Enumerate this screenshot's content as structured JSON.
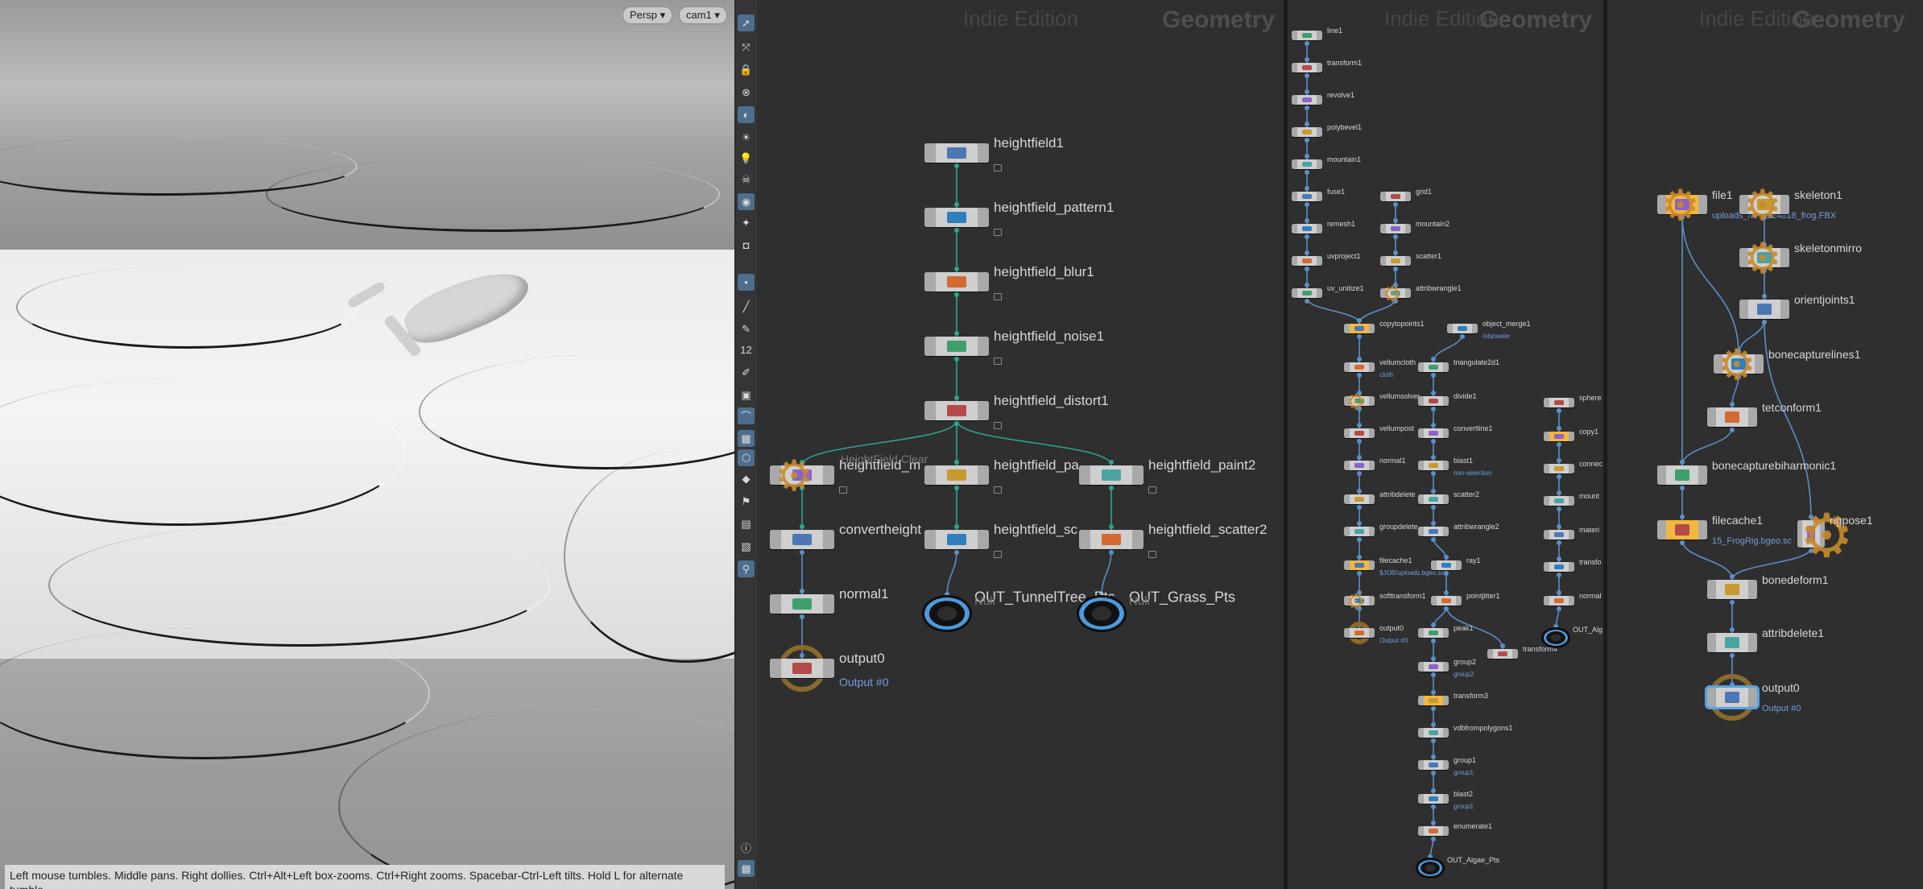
{
  "viewport": {
    "persp_label": "Persp ▾",
    "cam_label": "cam1 ▾",
    "hint_text": "Left mouse tumbles. Middle pans. Right dollies. Ctrl+Alt+Left box-zooms. Ctrl+Right zooms. Spacebar-Ctrl-Left tilts. Hold L for alternate tumble,"
  },
  "toolbar": {
    "icons": [
      "select-icon",
      "transform-icon",
      "lock-icon",
      "hide-icon",
      "shading-icon",
      "light-icon",
      "bulb-icon",
      "skull-icon",
      "camera-icon",
      "pose-icon",
      "snapshot-icon",
      "point-icon",
      "measure-icon",
      "pen-icon",
      "number-icon",
      "paint-icon",
      "stamp-icon",
      "curve-icon",
      "grid-icon",
      "wire-icon",
      "display-icon",
      "flag-icon",
      "image-icon",
      "background-icon",
      "pin-icon",
      "info-icon",
      "layout-icon"
    ],
    "twelve": "12"
  },
  "panes": {
    "pane1": {
      "edition": "Indie Edition",
      "context": "Geometry"
    },
    "pane2": {
      "edition": "Indie Edition",
      "context": "Geometry"
    },
    "pane3": {
      "edition": "Indie Edition",
      "context": "Geometry"
    }
  },
  "net1": {
    "nodes": [
      {
        "name": "heightfield1",
        "sub": ""
      },
      {
        "name": "heightfield_pattern1",
        "sub": ""
      },
      {
        "name": "heightfield_blur1",
        "sub": ""
      },
      {
        "name": "heightfield_noise1",
        "sub": ""
      },
      {
        "name": "heightfield_distort1",
        "sub": ""
      },
      {
        "name": "heightfield_m",
        "sub": ""
      },
      {
        "name": "heightfield_pa",
        "sub": ""
      },
      {
        "name": "heightfield_paint2",
        "sub": ""
      },
      {
        "name": "convertheight",
        "sub": ""
      },
      {
        "name": "heightfield_sc",
        "sub": ""
      },
      {
        "name": "heightfield_scatter2",
        "sub": ""
      },
      {
        "name": "normal1",
        "sub": ""
      },
      {
        "name": "output0",
        "sub": "Output #0"
      },
      {
        "name": "OUT_TunnelTree_Pts",
        "sub": "Null"
      },
      {
        "name": "OUT_Grass_Pts",
        "sub": "Null"
      }
    ],
    "comment": "HeightField Clear"
  },
  "net2": {
    "nodes": [
      {
        "name": "line1",
        "sub": ""
      },
      {
        "name": "transform1",
        "sub": ""
      },
      {
        "name": "revolve1",
        "sub": ""
      },
      {
        "name": "polybevel1",
        "sub": ""
      },
      {
        "name": "mountain1",
        "sub": ""
      },
      {
        "name": "fuse1",
        "sub": ""
      },
      {
        "name": "remesh1",
        "sub": ""
      },
      {
        "name": "uvproject1",
        "sub": ""
      },
      {
        "name": "uv_unitize1",
        "sub": ""
      },
      {
        "name": "grid1",
        "sub": ""
      },
      {
        "name": "mountain2",
        "sub": ""
      },
      {
        "name": "scatter1",
        "sub": ""
      },
      {
        "name": "attribwrangle1",
        "sub": ""
      },
      {
        "name": "copytopoints1",
        "sub": ""
      },
      {
        "name": "object_merge1",
        "sub": "/obj/water"
      },
      {
        "name": "vellumcloth",
        "sub": "cloth"
      },
      {
        "name": "vellumsolver",
        "sub": ""
      },
      {
        "name": "vellumpost",
        "sub": ""
      },
      {
        "name": "normal1",
        "sub": ""
      },
      {
        "name": "attribdelete",
        "sub": ""
      },
      {
        "name": "groupdelete",
        "sub": ""
      },
      {
        "name": "filecache1",
        "sub": "$JOB/uploads.bgeo.sc"
      },
      {
        "name": "softtransform1",
        "sub": ""
      },
      {
        "name": "output0",
        "sub": "Output #0"
      },
      {
        "name": "triangulate2d1",
        "sub": ""
      },
      {
        "name": "divide1",
        "sub": ""
      },
      {
        "name": "convertline1",
        "sub": ""
      },
      {
        "name": "blast1",
        "sub": "non-selection"
      },
      {
        "name": "scatter2",
        "sub": ""
      },
      {
        "name": "attribwrangle2",
        "sub": ""
      },
      {
        "name": "ray1",
        "sub": ""
      },
      {
        "name": "pointjitter1",
        "sub": ""
      },
      {
        "name": "peak1",
        "sub": ""
      },
      {
        "name": "transform4",
        "sub": ""
      },
      {
        "name": "group2",
        "sub": "group2"
      },
      {
        "name": "transform3",
        "sub": ""
      },
      {
        "name": "vdbfrompolygons1",
        "sub": ""
      },
      {
        "name": "group1",
        "sub": "group1"
      },
      {
        "name": "blast2",
        "sub": "group1"
      },
      {
        "name": "enumerate1",
        "sub": ""
      },
      {
        "name": "OUT_Algae_Pts",
        "sub": ""
      },
      {
        "name": "sphere",
        "sub": ""
      },
      {
        "name": "copy1",
        "sub": ""
      },
      {
        "name": "connec",
        "sub": ""
      },
      {
        "name": "mount",
        "sub": ""
      },
      {
        "name": "materi",
        "sub": ""
      },
      {
        "name": "transfo",
        "sub": ""
      },
      {
        "name": "normal",
        "sub": ""
      },
      {
        "name": "OUT_Alg",
        "sub": ""
      }
    ]
  },
  "net3": {
    "nodes": [
      {
        "name": "file1",
        "sub": "uploads_he…224818_frog.FBX"
      },
      {
        "name": "skeleton1",
        "sub": ""
      },
      {
        "name": "skeletonmirro",
        "sub": ""
      },
      {
        "name": "orientjoints1",
        "sub": ""
      },
      {
        "name": "bonecapturelines1",
        "sub": ""
      },
      {
        "name": "tetconform1",
        "sub": ""
      },
      {
        "name": "bonecapturebiharmonic1",
        "sub": ""
      },
      {
        "name": "filecache1",
        "sub": "15_FrogRig.bgeo.sc"
      },
      {
        "name": "rigpose1",
        "sub": ""
      },
      {
        "name": "bonedeform1",
        "sub": ""
      },
      {
        "name": "attribdelete1",
        "sub": ""
      },
      {
        "name": "output0",
        "sub": "Output #0"
      }
    ]
  },
  "colors": {
    "wire_green": "#2aa58f",
    "wire_blue": "#5b8fc7",
    "selected": "#f2b73f",
    "display": "#4ea3e6",
    "sub_text": "#6f9fdc"
  }
}
